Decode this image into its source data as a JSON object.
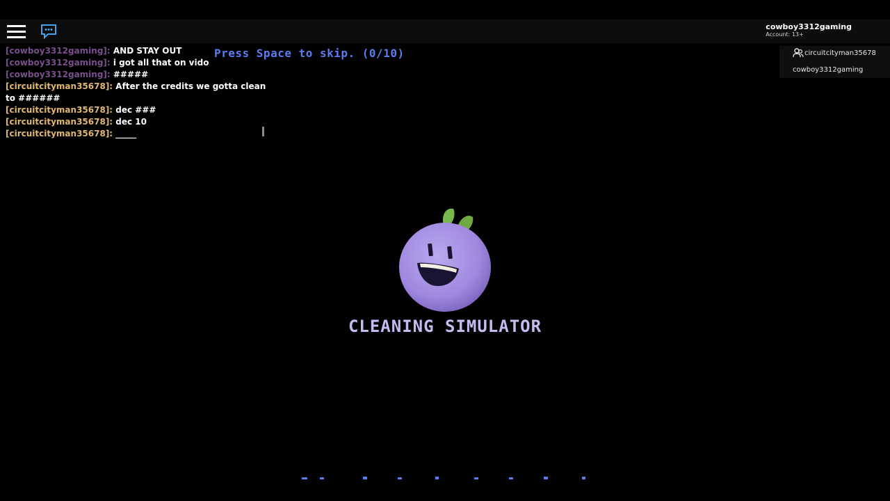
{
  "topbar": {
    "account_name": "cowboy3312gaming",
    "account_age": "Account: 13+"
  },
  "skip_prompt": "Press Space to skip. (0/10)",
  "chat": {
    "lines": [
      {
        "speaker": "[cowboy3312gaming]:",
        "message": "AND STAY OUT",
        "speaker_color": "#7a4f8c"
      },
      {
        "speaker": "[cowboy3312gaming]:",
        "message": "i got all that on vido",
        "speaker_color": "#7a4f8c"
      },
      {
        "speaker": "[cowboy3312gaming]:",
        "message": "#####",
        "speaker_color": "#7a4f8c"
      },
      {
        "speaker": "[circuitcityman35678]:",
        "message": "After the credits we gotta clean to ######",
        "speaker_color": "#e0b870"
      },
      {
        "speaker": "[circuitcityman35678]:",
        "message": "dec ###",
        "speaker_color": "#e0b870"
      },
      {
        "speaker": "[circuitcityman35678]:",
        "message": "dec 10",
        "speaker_color": "#e0b870"
      },
      {
        "speaker": "[circuitcityman35678]:",
        "message": "_____",
        "speaker_color": "#e0b870"
      }
    ]
  },
  "playerlist": {
    "players": [
      {
        "name": "circuitcityman35678",
        "icon": "friends-icon"
      },
      {
        "name": "cowboy3312gaming",
        "icon": ""
      }
    ]
  },
  "game": {
    "title": "CLEANING SIMULATOR",
    "logo": "purple-blob-mascot"
  },
  "colors": {
    "background": "#000000",
    "topbar": "#0d0d0d",
    "skip_prompt": "#5b7df2",
    "title": "#c2bdf0",
    "mascot": "#a48fe0",
    "leaf": "#7cba4a",
    "chat_icon": "#4aa3e8"
  }
}
